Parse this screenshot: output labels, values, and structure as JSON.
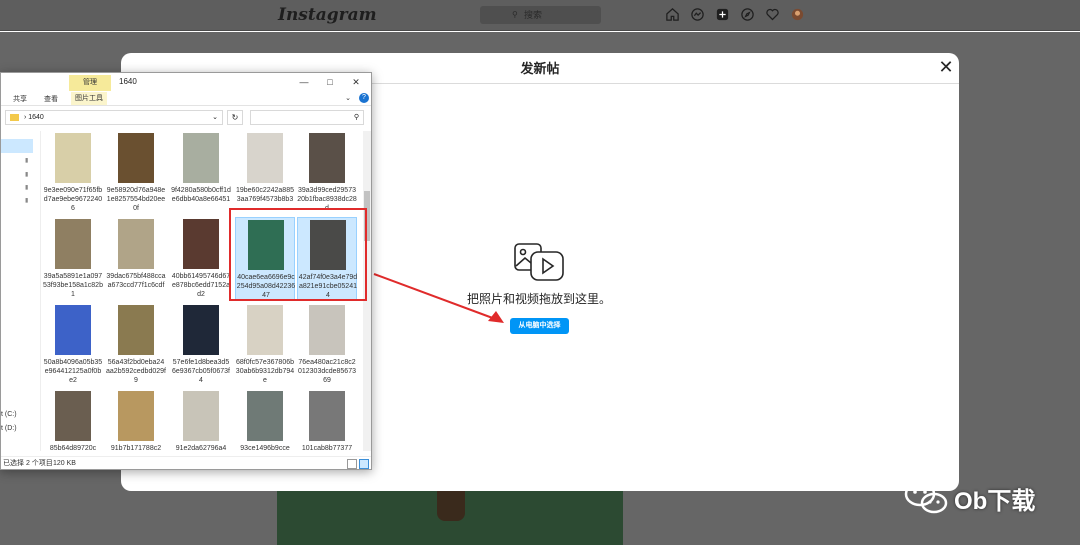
{
  "instagram": {
    "logo": "Instagram",
    "search_placeholder": "搜索",
    "nav_icons": [
      "home-icon",
      "messenger-icon",
      "new-post-icon",
      "explore-icon",
      "heart-icon",
      "avatar"
    ]
  },
  "modal": {
    "title": "发新帖",
    "drop_text": "把照片和视频拖放到这里。",
    "select_button": "从电脑中选择",
    "accent_color": "#0095f6"
  },
  "explorer": {
    "manage_tab": "管理",
    "folder_title": "1640",
    "ribbon": {
      "share": "共享",
      "view": "查看",
      "picture_tools": "图片工具"
    },
    "address": "1640",
    "nav_drives": [
      "t (C:)",
      "t (D:)"
    ],
    "files": [
      {
        "name": "9e3ee090e71f65fbd7ae9ebe96722406",
        "color": "#d8cfa8",
        "selected": false
      },
      {
        "name": "9e58920d76a948e1e8257554bd20ee0f",
        "color": "#6a5030",
        "selected": false
      },
      {
        "name": "9f4280a580b0cff1de6dbb40a8e66451",
        "color": "#a8aea0",
        "selected": false
      },
      {
        "name": "19be60c2242a8853aa769f4573b8b3",
        "color": "#d8d4cc",
        "selected": false
      },
      {
        "name": "39a3d99ced2957320b1fbac8938dc28d",
        "color": "#5a5048",
        "selected": false
      },
      {
        "name": "39a5a5891e1a09753f93be158a1c82b1",
        "color": "#8f7f62",
        "selected": false
      },
      {
        "name": "39dac675bf488ccaa673ccd77f1c6cdf",
        "color": "#b0a488",
        "selected": false
      },
      {
        "name": "40bb61495746d67e878bc6edd7152ad2",
        "color": "#5a3a30",
        "selected": false
      },
      {
        "name": "40cae6ea6696e9c254d95a08d4223647",
        "color": "#2f6e54",
        "selected": true
      },
      {
        "name": "42af74f0e3a4e79da821e91cbe052414",
        "color": "#4a4a48",
        "selected": true
      },
      {
        "name": "50a8b4096a05b35e964412125a0f0be2",
        "color": "#3d62c8",
        "selected": false
      },
      {
        "name": "56a43f2bd0eba24aa2b592cedbd029f9",
        "color": "#8a7a50",
        "selected": false
      },
      {
        "name": "57e6fe1d8bea3d56e9367cb05f0673f4",
        "color": "#1f2838",
        "selected": false
      },
      {
        "name": "68f0fc57e367806b30ab6b9312db794e",
        "color": "#d8d2c4",
        "selected": false
      },
      {
        "name": "76ea480ac21c8c2012303dcde8567369",
        "color": "#c8c4bc",
        "selected": false
      },
      {
        "name": "85b64d89720c",
        "color": "#6a5e50",
        "selected": false
      },
      {
        "name": "91b7b171788c2",
        "color": "#b89860",
        "selected": false
      },
      {
        "name": "91e2da62796a4",
        "color": "#c8c4b8",
        "selected": false
      },
      {
        "name": "93ce1496b9cce",
        "color": "#6f7a76",
        "selected": false
      },
      {
        "name": "101cab8b77377",
        "color": "#787878",
        "selected": false
      }
    ],
    "status_selected": "已选择 2 个项目",
    "status_size": "120 KB"
  },
  "watermark": "Ob下载"
}
